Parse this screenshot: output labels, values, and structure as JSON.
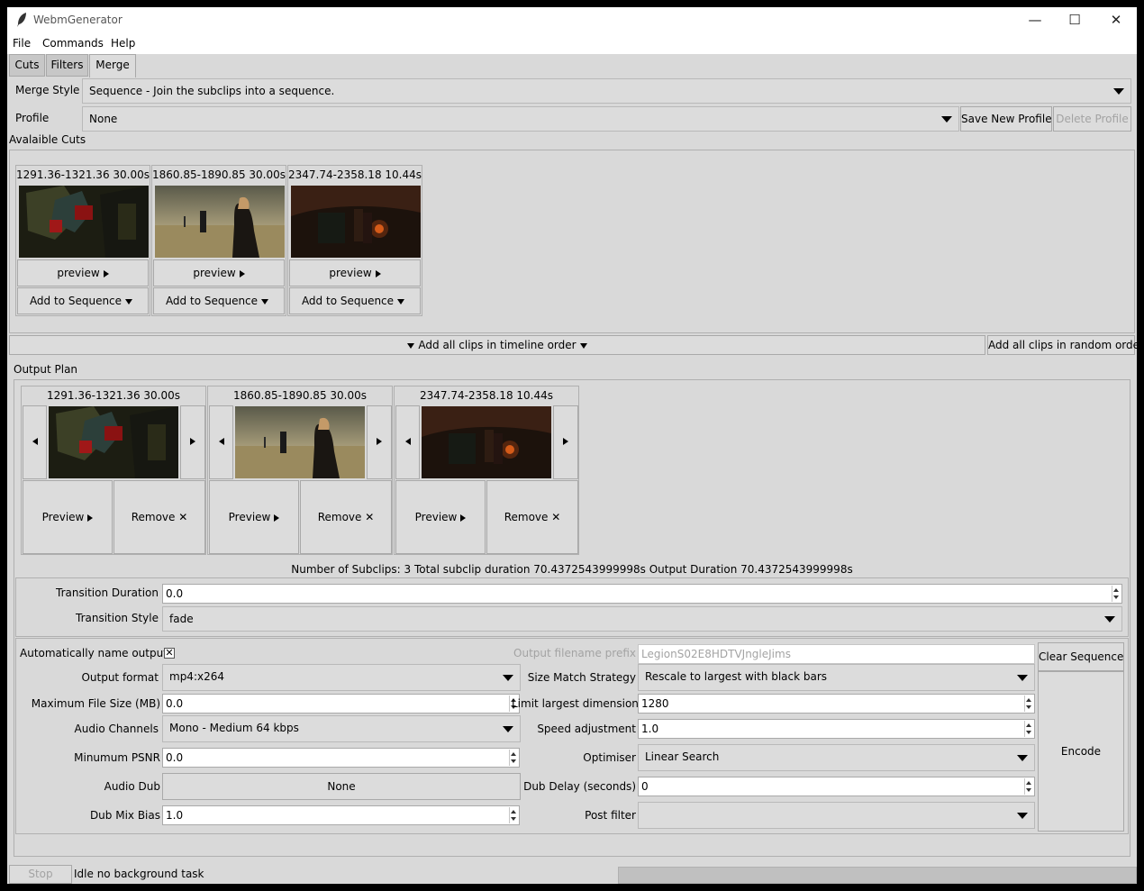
{
  "window": {
    "title": "WebmGenerator",
    "minimize": "—",
    "maximize": "☐",
    "close": "✕"
  },
  "menu": [
    "File",
    "Commands",
    "Help"
  ],
  "tabs": [
    "Cuts",
    "Filters",
    "Merge"
  ],
  "merge_style": {
    "label": "Merge Style",
    "value": "Sequence - Join the subclips into a sequence."
  },
  "profile": {
    "label": "Profile",
    "value": "None",
    "save": "Save New Profile",
    "delete": "Delete Profile"
  },
  "available": {
    "label": "Avalaible Cuts",
    "preview": "preview",
    "add": "Add to Sequence",
    "cuts": [
      "1291.36-1321.36 30.00s",
      "1860.85-1890.85 30.00s",
      "2347.74-2358.18 10.44s"
    ]
  },
  "add_timeline": "Add all clips in timeline order",
  "add_random": "Add all clips in random order",
  "output_plan": {
    "label": "Output Plan",
    "preview": "Preview",
    "remove": "Remove",
    "clips": [
      "1291.36-1321.36 30.00s",
      "1860.85-1890.85 30.00s",
      "2347.74-2358.18 10.44s"
    ]
  },
  "summary": "Number of Subclips: 3 Total subclip duration 70.4372543999998s Output Duration 70.4372543999998s",
  "transition": {
    "duration_label": "Transition Duration",
    "duration": "0.0",
    "style_label": "Transition Style",
    "style": "fade"
  },
  "settings": {
    "auto_name_label": "Automatically name output",
    "prefix_label": "Output filename prefix",
    "prefix": "LegionS02E8HDTVJngleJims",
    "format_label": "Output format",
    "format": "mp4:x264",
    "max_size_label": "Maximum File Size (MB)",
    "max_size": "0.0",
    "audio_label": "Audio Channels",
    "audio": "Mono - Medium 64 kbps",
    "psnr_label": "Minumum PSNR",
    "psnr": "0.0",
    "dub_label": "Audio Dub",
    "dub": "None",
    "mix_label": "Dub Mix Bias",
    "mix": "1.0",
    "size_strategy_label": "Size Match Strategy",
    "size_strategy": "Rescale to largest with black bars",
    "limit_label": "Limit largest dimension",
    "limit": "1280",
    "speed_label": "Speed adjustment",
    "speed": "1.0",
    "optimiser_label": "Optimiser",
    "optimiser": "Linear Search",
    "dub_delay_label": "Dub Delay (seconds)",
    "dub_delay": "0",
    "post_filter_label": "Post filter",
    "post_filter": ""
  },
  "clear": "Clear Sequence",
  "encode": "Encode",
  "status": {
    "stop": "Stop",
    "text": "Idle no background task"
  }
}
